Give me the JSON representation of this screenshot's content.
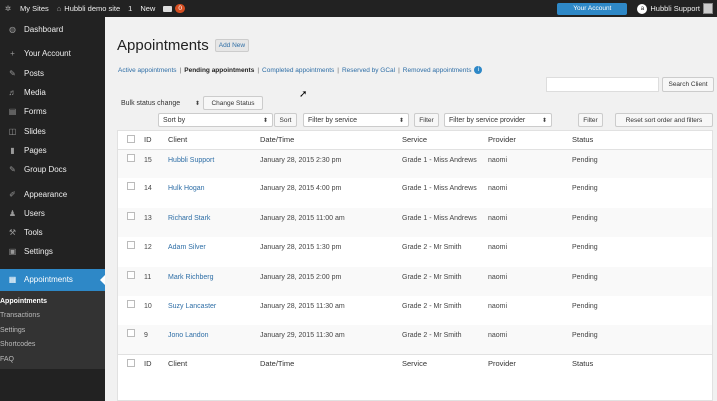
{
  "adminbar": {
    "my_sites": "My Sites",
    "site_name": "Hubbli demo site",
    "updates_count": "1",
    "new_label": "New",
    "comments_count": "0",
    "your_account": "Your Account",
    "user_name": "Hubbli Support",
    "avatar_initial": "a"
  },
  "sidebar": {
    "items": [
      {
        "label": "Dashboard",
        "icon": "dashboard-icon",
        "glyph": "◍"
      },
      {
        "label": "Your Account",
        "icon": "plus-icon",
        "glyph": "+"
      },
      {
        "label": "Posts",
        "icon": "pin-icon",
        "glyph": "✎"
      },
      {
        "label": "Media",
        "icon": "media-icon",
        "glyph": "♬"
      },
      {
        "label": "Forms",
        "icon": "forms-icon",
        "glyph": "▤"
      },
      {
        "label": "Slides",
        "icon": "slides-icon",
        "glyph": "◫"
      },
      {
        "label": "Pages",
        "icon": "pages-icon",
        "glyph": "▮"
      },
      {
        "label": "Group Docs",
        "icon": "pin-icon",
        "glyph": "✎"
      },
      {
        "label": "Appearance",
        "icon": "brush-icon",
        "glyph": "✐"
      },
      {
        "label": "Users",
        "icon": "users-icon",
        "glyph": "♟"
      },
      {
        "label": "Tools",
        "icon": "wrench-icon",
        "glyph": "⚒"
      },
      {
        "label": "Settings",
        "icon": "settings-icon",
        "glyph": "▣"
      }
    ],
    "current": {
      "label": "Appointments",
      "icon": "calendar-icon",
      "glyph": "▦"
    },
    "submenu": [
      "Appointments",
      "Transactions",
      "Settings",
      "Shortcodes",
      "FAQ"
    ]
  },
  "main": {
    "title": "Appointments",
    "add_new": "Add New",
    "filters": [
      {
        "label": "Active appointments",
        "current": false
      },
      {
        "label": "Pending appointments",
        "current": true
      },
      {
        "label": "Completed appointments",
        "current": false
      },
      {
        "label": "Reserved by GCal",
        "current": false
      },
      {
        "label": "Removed appointments",
        "current": false
      }
    ],
    "search_button": "Search Client",
    "bulk_select": "Bulk status change",
    "change_status": "Change Status",
    "sort_select": "Sort by",
    "sort_button": "Sort",
    "service_select": "Filter by service",
    "filter_button": "Filter",
    "provider_select": "Filter by service provider",
    "reset_button": "Reset sort order and filters"
  },
  "table": {
    "columns": [
      "ID",
      "Client",
      "Date/Time",
      "Service",
      "Provider",
      "Status"
    ],
    "rows": [
      {
        "id": "15",
        "client": "Hubbli Support",
        "datetime": "January 28, 2015 2:30 pm",
        "service": "Grade 1 - Miss Andrews",
        "provider": "naomi",
        "status": "Pending"
      },
      {
        "id": "14",
        "client": "Hulk Hogan",
        "datetime": "January 28, 2015 4:00 pm",
        "service": "Grade 1 - Miss Andrews",
        "provider": "naomi",
        "status": "Pending"
      },
      {
        "id": "13",
        "client": "Richard Stark",
        "datetime": "January 28, 2015 11:00 am",
        "service": "Grade 1 - Miss Andrews",
        "provider": "naomi",
        "status": "Pending"
      },
      {
        "id": "12",
        "client": "Adam Silver",
        "datetime": "January 28, 2015 1:30 pm",
        "service": "Grade 2 - Mr Smith",
        "provider": "naomi",
        "status": "Pending"
      },
      {
        "id": "11",
        "client": "Mark Richberg",
        "datetime": "January 28, 2015 2:00 pm",
        "service": "Grade 2 - Mr Smith",
        "provider": "naomi",
        "status": "Pending"
      },
      {
        "id": "10",
        "client": "Suzy Lancaster",
        "datetime": "January 28, 2015 11:30 am",
        "service": "Grade 2 - Mr Smith",
        "provider": "naomi",
        "status": "Pending"
      },
      {
        "id": "9",
        "client": "Jono Landon",
        "datetime": "January 29, 2015 11:30 am",
        "service": "Grade 2 - Mr Smith",
        "provider": "naomi",
        "status": "Pending"
      }
    ]
  },
  "colors": {
    "adminbar_bg": "#222222",
    "accent": "#2e88c7",
    "link": "#2e6ea6",
    "badge": "#d54e21"
  }
}
